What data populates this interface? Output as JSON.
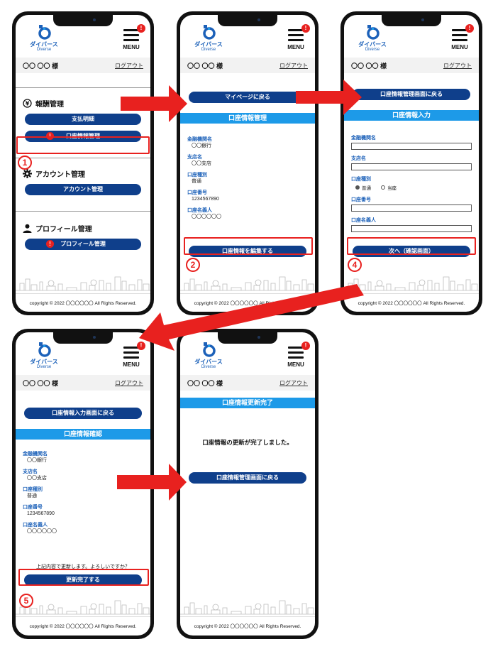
{
  "app": {
    "brand_jp": "ダイバース",
    "brand_en": "Diverse",
    "menu_label": "MENU",
    "notif_mark": "!",
    "user_name": "〇〇 〇〇 様",
    "logout": "ログアウト",
    "copyright": "copyright © 2022 〇〇〇〇〇〇 All Rights Reserved.",
    "colors": {
      "primary": "#0f3f8b",
      "band": "#1d9ae8",
      "highlight": "#e8211f",
      "label": "#1c61b9"
    }
  },
  "screen1": {
    "compensation_title": "報酬管理",
    "payment_details": "支払明細",
    "bank_info_mgmt": "口座情報管理",
    "account_title": "アカウント管理",
    "account_mgmt": "アカウント管理",
    "profile_title": "プロフィール管理",
    "profile_mgmt": "プロフィール管理",
    "step": "1"
  },
  "screen2": {
    "back_mypage": "マイページに戻る",
    "band": "口座情報管理",
    "fields": [
      {
        "label": "金融機関名",
        "value": "〇〇銀行"
      },
      {
        "label": "支店名",
        "value": "〇〇支店"
      },
      {
        "label": "口座種別",
        "value": "普通"
      },
      {
        "label": "口座番号",
        "value": "1234567890"
      },
      {
        "label": "口座名義人",
        "value": "〇〇〇〇〇〇"
      }
    ],
    "edit_button": "口座情報を編集する",
    "step": "2"
  },
  "screen3": {
    "back_button": "口座情報管理画面に戻る",
    "band": "口座情報入力",
    "labels": {
      "bank": "金融機関名",
      "branch": "支店名",
      "type": "口座種別",
      "number": "口座番号",
      "holder": "口座名義人"
    },
    "type_options": [
      "普通",
      "当座"
    ],
    "next_button": "次へ（確認画面）",
    "step": "4"
  },
  "screen4": {
    "back_button": "口座情報入力画面に戻る",
    "band": "口座情報確認",
    "fields": [
      {
        "label": "金融機関名",
        "value": "〇〇銀行"
      },
      {
        "label": "支店名",
        "value": "〇〇支店"
      },
      {
        "label": "口座種別",
        "value": "普通"
      },
      {
        "label": "口座番号",
        "value": "1234567890"
      },
      {
        "label": "口座名義人",
        "value": "〇〇〇〇〇〇"
      }
    ],
    "confirm_text": "上記内容で更新します。よろしいですか？",
    "complete_button": "更新完了する",
    "step": "5"
  },
  "screen5": {
    "band": "口座情報更新完了",
    "message": "口座情報の更新が完了しました。",
    "back_button": "口座情報管理画面に戻る"
  }
}
